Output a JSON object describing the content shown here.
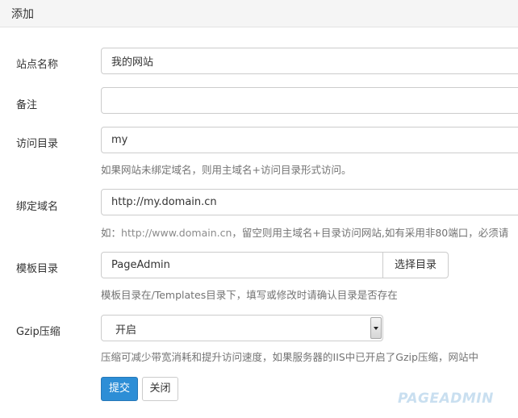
{
  "panel": {
    "title": "添加"
  },
  "fields": {
    "site_name": {
      "label": "站点名称",
      "value": "我的网站"
    },
    "remark": {
      "label": "备注",
      "value": ""
    },
    "access_dir": {
      "label": "访问目录",
      "value": "my",
      "help": "如果网站未绑定域名，则用主域名+访问目录形式访问。"
    },
    "bind_domain": {
      "label": "绑定域名",
      "value": "http://my.domain.cn",
      "help_prefix": "如：",
      "help_url": "http://www.domain.cn",
      "help_rest": "，留空则用主域名+目录访问网站,如有采用非80端口，必须请"
    },
    "template_dir": {
      "label": "模板目录",
      "value": "PageAdmin",
      "button": "选择目录",
      "help": "模板目录在/Templates目录下，填写或修改时请确认目录是否存在"
    },
    "gzip": {
      "label": "Gzip压缩",
      "selected": "开启",
      "help": "压缩可减少带宽消耗和提升访问速度，如果服务器的IIS中已开启了Gzip压缩，网站中"
    }
  },
  "actions": {
    "submit": "提交",
    "close": "关闭"
  },
  "watermark": "PAGEADMIN"
}
